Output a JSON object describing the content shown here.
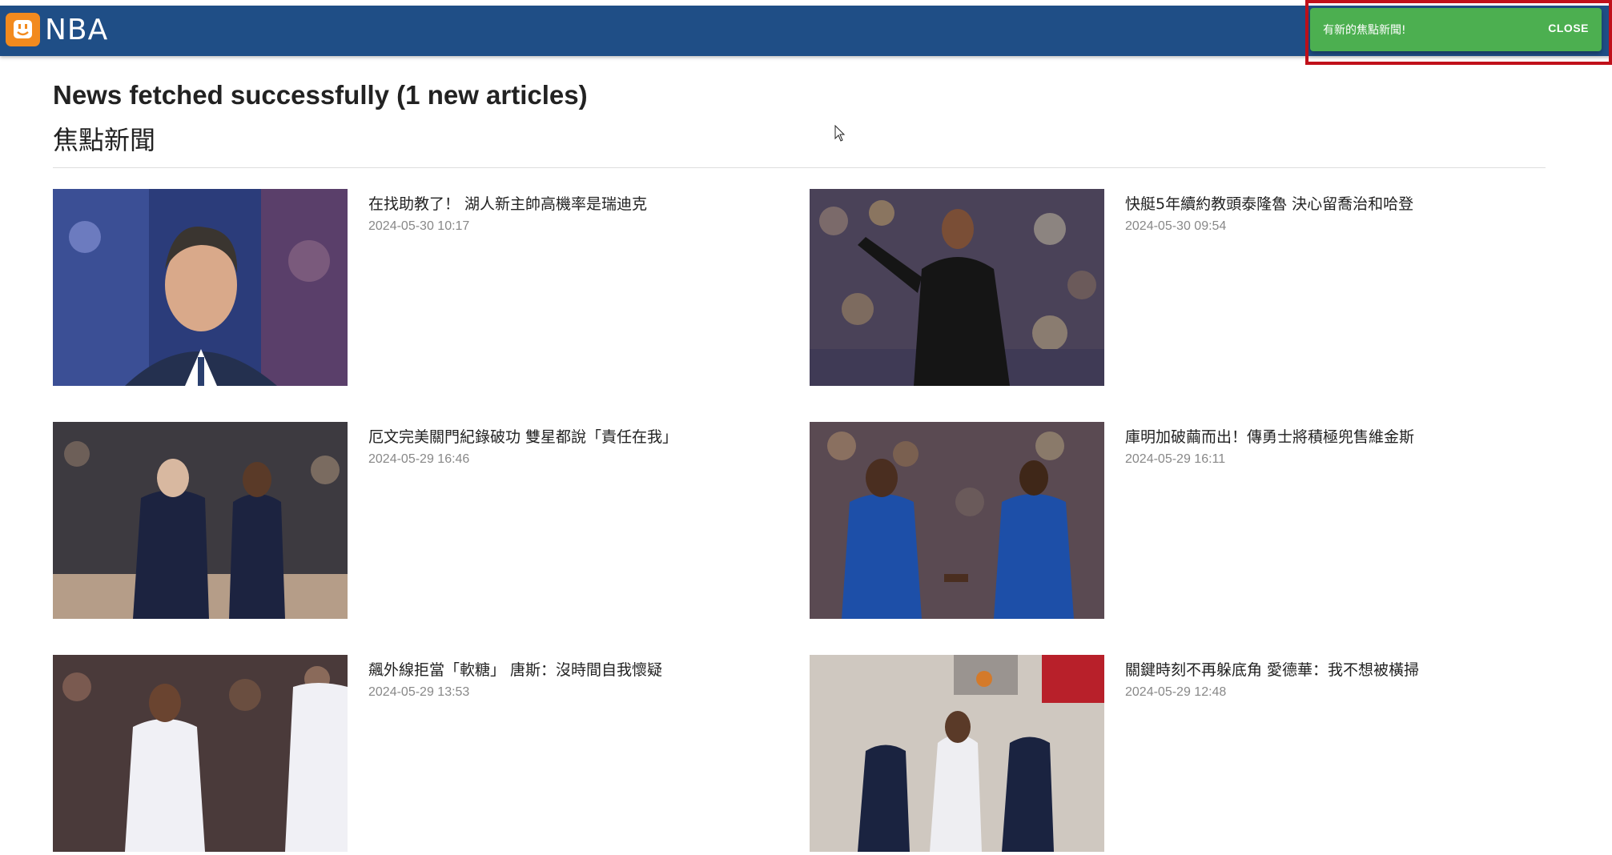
{
  "appbar": {
    "brand": "NBA",
    "logo_icon": "app-logo-icon",
    "bg_color": "#1f4e86"
  },
  "toast": {
    "message": "有新的焦點新聞!",
    "close_label": "CLOSE",
    "bg_color": "#4caf50"
  },
  "status": {
    "title": "News fetched successfully (1 new articles)"
  },
  "section": {
    "title": "焦點新聞"
  },
  "articles": [
    {
      "title": "在找助教了！ 湖人新主帥高機率是瑞迪克",
      "time": "2024-05-30 10:17"
    },
    {
      "title": "快艇5年續約教頭泰隆魯 決心留喬治和哈登",
      "time": "2024-05-30 09:54"
    },
    {
      "title": "厄文完美關門紀錄破功 雙星都說「責任在我」",
      "time": "2024-05-29 16:46"
    },
    {
      "title": "庫明加破繭而出！傳勇士將積極兜售維金斯",
      "time": "2024-05-29 16:11"
    },
    {
      "title": "飆外線拒當「軟糖」 唐斯：沒時間自我懷疑",
      "time": "2024-05-29 13:53"
    },
    {
      "title": "關鍵時刻不再躲底角 愛德華：我不想被橫掃",
      "time": "2024-05-29 12:48"
    }
  ]
}
